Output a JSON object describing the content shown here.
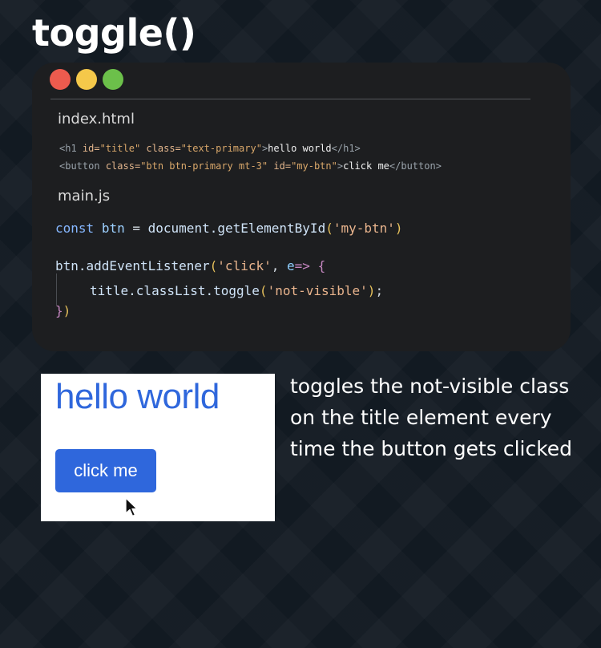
{
  "title": "toggle()",
  "code_window": {
    "colors": {
      "close": "#ed5b4e",
      "minimize": "#f5c84a",
      "maximize": "#6cc04a"
    },
    "html_file": {
      "name": "index.html",
      "line1": {
        "open_bracket": "<",
        "tag": "h1",
        "attr1": "id=",
        "val1": "\"title\"",
        "attr2": "class=",
        "val2": "\"text-primary\"",
        "close_bracket": ">",
        "text": "hello world",
        "end_tag": "</h1>"
      },
      "line2": {
        "open_bracket": "<",
        "tag": "button",
        "attr1": "class=",
        "val1": "\"btn btn-primary mt-3\"",
        "attr2": "id=",
        "val2": "\"my-btn\"",
        "close_bracket": ">",
        "text": "click me",
        "end_tag": "</button>"
      }
    },
    "js_file": {
      "name": "main.js",
      "line1": {
        "kw": "const",
        "var": "btn",
        "op": "=",
        "obj": "document.getElementById",
        "open": "(",
        "arg": "'my-btn'",
        "close": ")"
      },
      "line2": {
        "obj": "btn.addEventListener",
        "open": "(",
        "arg": "'click'",
        "comma": ",",
        "param": "e",
        "arrow": "=>",
        "brace": "{"
      },
      "line3": {
        "obj": "title.classList.toggle",
        "open": "(",
        "arg": "'not-visible'",
        "close": ")",
        "semi": ";"
      },
      "line4": {
        "brace": "}",
        "close": ")"
      }
    }
  },
  "demo": {
    "heading": "hello world",
    "button_label": "click me",
    "color": "#2f67dc"
  },
  "caption": "toggles the not-visible class on the title element every time the button gets clicked"
}
